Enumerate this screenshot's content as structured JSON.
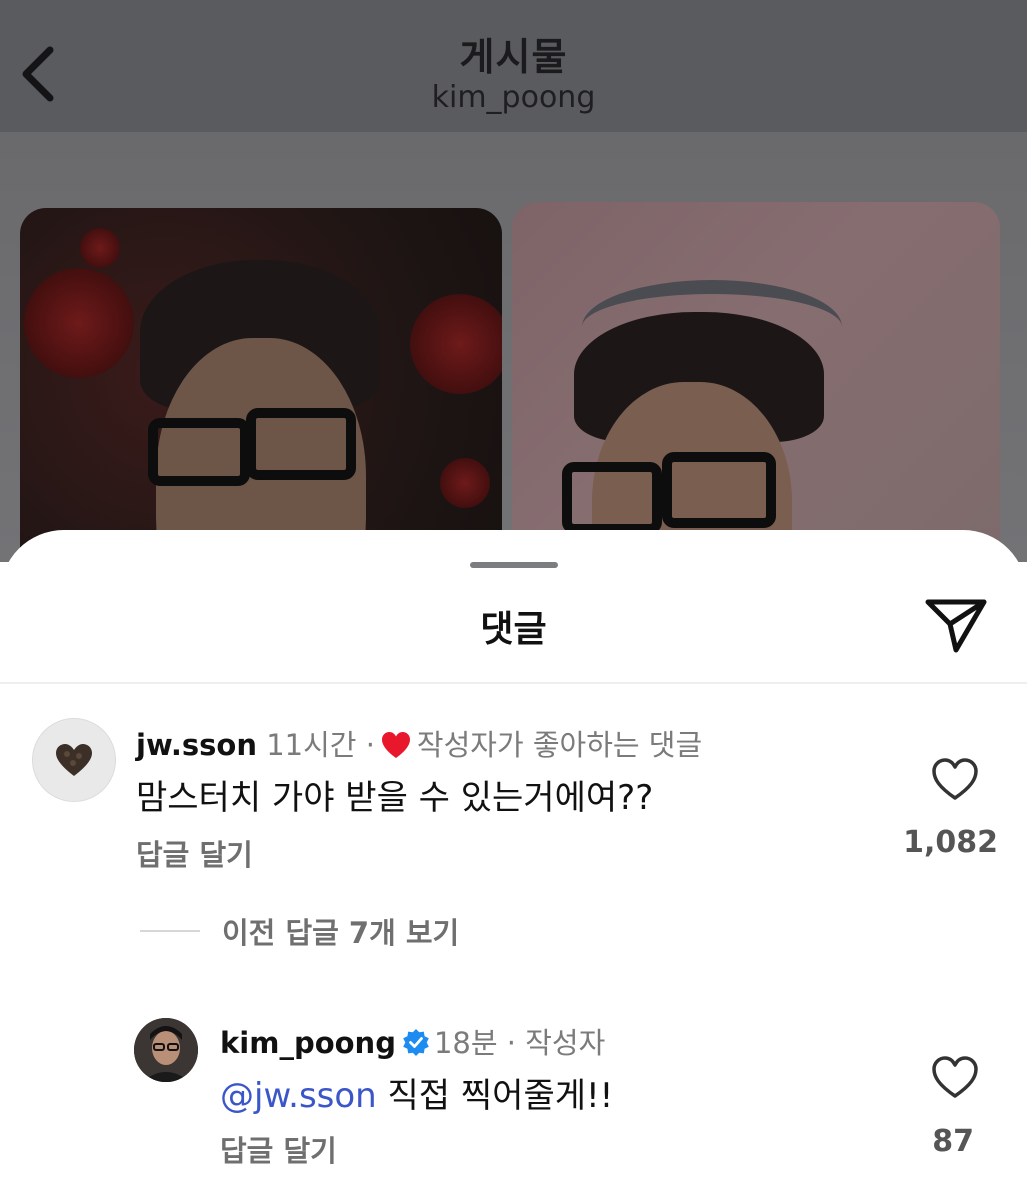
{
  "header": {
    "title": "게시물",
    "subtitle": "kim_poong"
  },
  "sheet": {
    "title": "댓글"
  },
  "comments": [
    {
      "username": "jw.sson",
      "time": "11시간",
      "separator": "·",
      "badge": "작성자가 좋아하는 댓글",
      "text": "맘스터치 가야 받을 수 있는거에여??",
      "reply_label": "답글 달기",
      "like_count": "1,082"
    }
  ],
  "view_replies": "이전 답글 7개 보기",
  "reply": {
    "username": "kim_poong",
    "time": "18분",
    "separator": "·",
    "role": "작성자",
    "mention": "@jw.sson",
    "text": " 직접 찍어줄게!!",
    "reply_label": "답글 달기",
    "like_count": "87"
  },
  "colors": {
    "liked_heart": "#e8172c",
    "mention": "#3a56c9",
    "verified": "#1d8cf0"
  },
  "icons": [
    "back-chevron-icon",
    "share-icon",
    "heart-icon",
    "verified-icon"
  ]
}
